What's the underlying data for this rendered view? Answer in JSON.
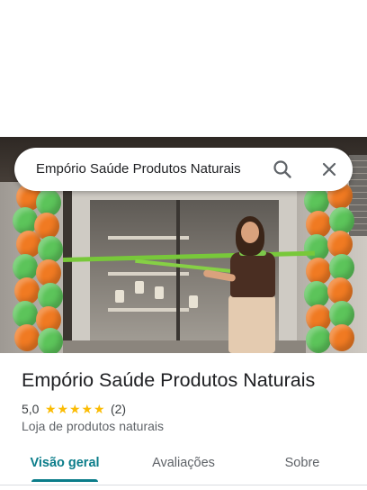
{
  "search": {
    "query": "Empório Saúde Produtos Naturais",
    "search_icon": "search-icon",
    "close_icon": "close-icon"
  },
  "place": {
    "name": "Empório Saúde Produtos Naturais",
    "rating": "5,0",
    "stars": 5,
    "review_count": "(2)",
    "category": "Loja de produtos naturais",
    "star_color": "#fbbc04"
  },
  "tabs": [
    {
      "label": "Visão geral",
      "active": true
    },
    {
      "label": "Avaliações",
      "active": false
    },
    {
      "label": "Sobre",
      "active": false
    }
  ],
  "colors": {
    "accent": "#0b7d8a",
    "text_primary": "#202124",
    "text_secondary": "#5f6368"
  }
}
